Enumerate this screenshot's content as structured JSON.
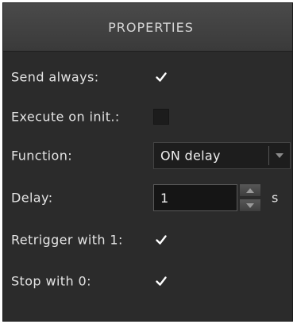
{
  "panel": {
    "title": "PROPERTIES"
  },
  "fields": {
    "send_always": {
      "label": "Send always:",
      "checked": true
    },
    "execute_on_init": {
      "label": "Execute on init.:",
      "checked": false
    },
    "function": {
      "label": "Function:",
      "value": "ON delay"
    },
    "delay": {
      "label": "Delay:",
      "value": "1",
      "unit": "s"
    },
    "retrigger": {
      "label": "Retrigger with 1:",
      "checked": true
    },
    "stop_with_0": {
      "label": "Stop with 0:",
      "checked": true
    }
  },
  "colors": {
    "panel_bg": "#2b2b2b",
    "header_bg": "#404040",
    "text": "#e4e4e4",
    "checkmark": "#ffffff"
  },
  "icons": {
    "checkbox": "check-icon",
    "dropdown": "chevron-down-icon",
    "spin_up": "chevron-up-icon",
    "spin_down": "chevron-down-icon"
  }
}
